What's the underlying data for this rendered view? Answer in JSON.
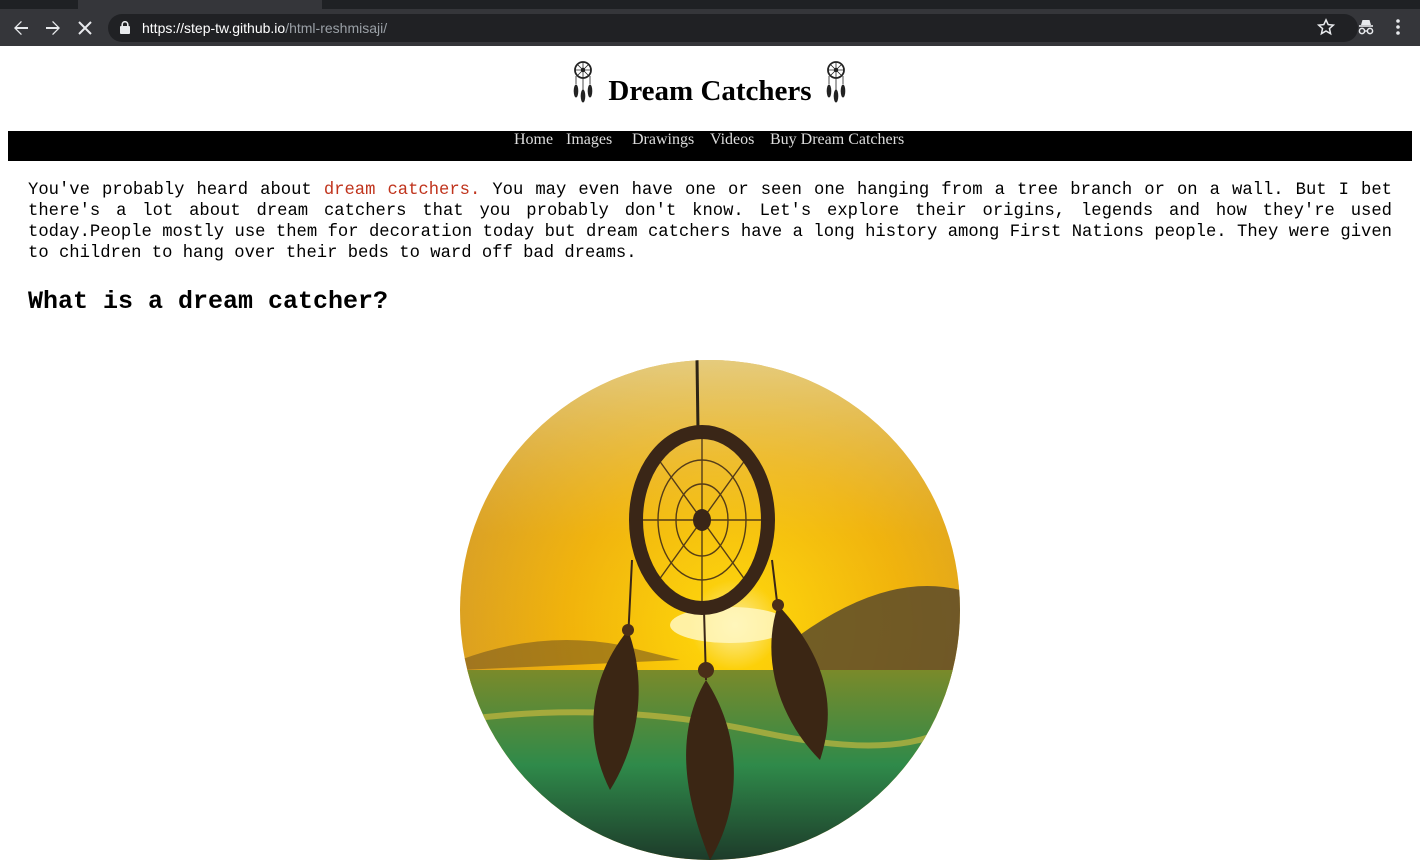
{
  "browser": {
    "url_host": "https://step-tw.github.io",
    "url_path": "/html-reshmisaji/"
  },
  "page": {
    "title": "Dream Catchers",
    "nav": [
      "Home",
      "Images",
      "Drawings",
      "Videos",
      "Buy Dream Catchers"
    ],
    "intro_before": "You've probably heard about ",
    "intro_link": "dream catchers.",
    "intro_after": " You may even have one or seen one hanging from a tree branch or on a wall. But I bet there's a lot about dream catchers that you probably don't know. Let's explore their origins, legends and how they're used today.People mostly use them for decoration today but dream catchers have a long history among First Nations people. They were given to children to hang over their beds to ward off bad dreams.",
    "heading": "What is a dream catcher?"
  },
  "colors": {
    "navbar_bg": "#000000",
    "link_accent": "#c0341d",
    "chrome_bg": "#35363a"
  },
  "icons": [
    "back-arrow-icon",
    "forward-arrow-icon",
    "stop-loading-icon",
    "lock-icon",
    "bookmark-star-icon",
    "incognito-icon",
    "more-menu-icon",
    "dream-catcher-logo-icon"
  ]
}
